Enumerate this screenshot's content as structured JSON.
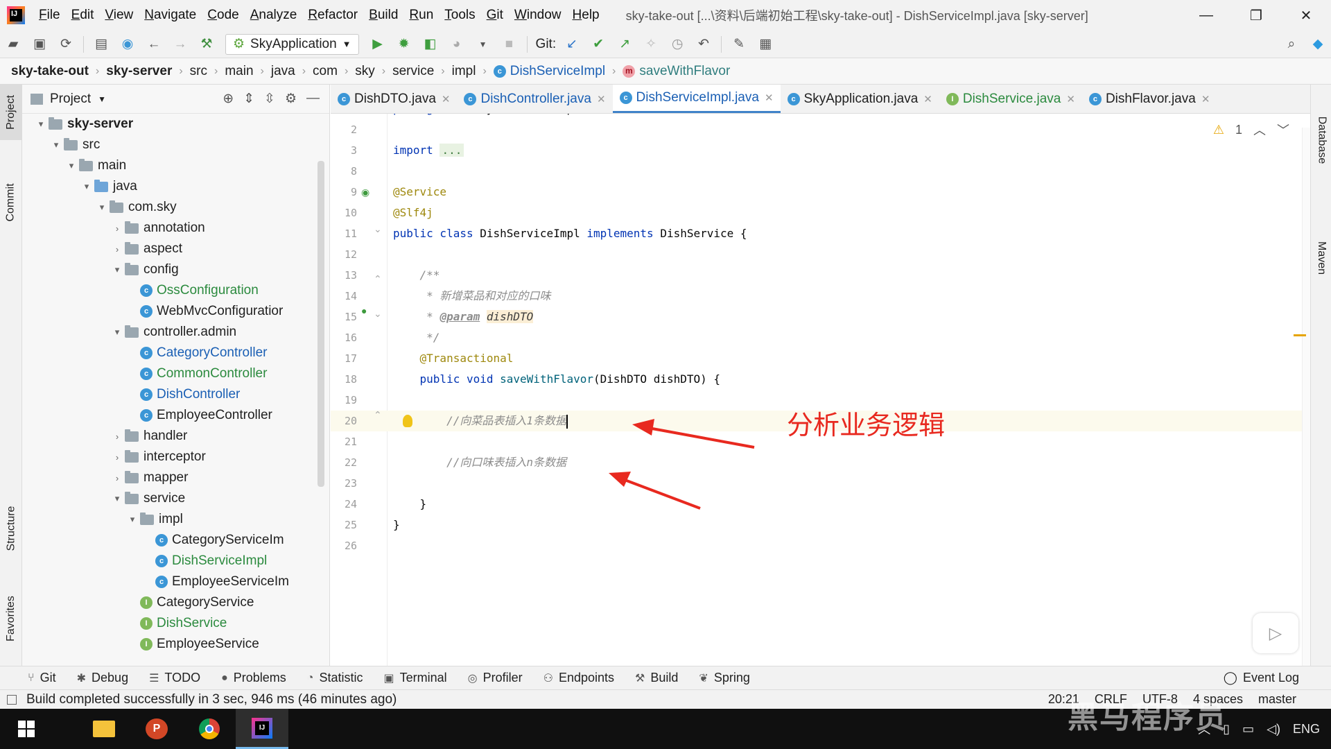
{
  "menu": {
    "items": [
      "File",
      "Edit",
      "View",
      "Navigate",
      "Code",
      "Analyze",
      "Refactor",
      "Build",
      "Run",
      "Tools",
      "Git",
      "Window",
      "Help"
    ],
    "window_title": "sky-take-out [...\\资料\\后端初始工程\\sky-take-out] - DishServiceImpl.java [sky-server]"
  },
  "toolbar": {
    "run_config": "SkyApplication",
    "git_label": "Git:"
  },
  "breadcrumb": [
    "sky-take-out",
    "sky-server",
    "src",
    "main",
    "java",
    "com",
    "sky",
    "service",
    "impl",
    "DishServiceImpl",
    "saveWithFlavor"
  ],
  "left_strip": {
    "project": "Project",
    "commit": "Commit",
    "structure": "Structure",
    "favorites": "Favorites"
  },
  "right_strip": {
    "database": "Database",
    "maven": "Maven"
  },
  "project_panel": {
    "title": "Project",
    "tree": [
      {
        "label": "sky-server",
        "depth": 0,
        "arrow": "▾",
        "kind": "module",
        "style": "bold"
      },
      {
        "label": "src",
        "depth": 1,
        "arrow": "▾",
        "kind": "folder"
      },
      {
        "label": "main",
        "depth": 2,
        "arrow": "▾",
        "kind": "folder"
      },
      {
        "label": "java",
        "depth": 3,
        "arrow": "▾",
        "kind": "folder-blue"
      },
      {
        "label": "com.sky",
        "depth": 4,
        "arrow": "▾",
        "kind": "folder"
      },
      {
        "label": "annotation",
        "depth": 5,
        "arrow": "›",
        "kind": "folder"
      },
      {
        "label": "aspect",
        "depth": 5,
        "arrow": "›",
        "kind": "folder"
      },
      {
        "label": "config",
        "depth": 5,
        "arrow": "▾",
        "kind": "folder"
      },
      {
        "label": "OssConfiguration",
        "depth": 6,
        "arrow": "",
        "kind": "class",
        "style": "green"
      },
      {
        "label": "WebMvcConfiguratior",
        "depth": 6,
        "arrow": "",
        "kind": "class"
      },
      {
        "label": "controller.admin",
        "depth": 5,
        "arrow": "▾",
        "kind": "folder"
      },
      {
        "label": "CategoryController",
        "depth": 6,
        "arrow": "",
        "kind": "class",
        "style": "blue"
      },
      {
        "label": "CommonController",
        "depth": 6,
        "arrow": "",
        "kind": "class",
        "style": "green"
      },
      {
        "label": "DishController",
        "depth": 6,
        "arrow": "",
        "kind": "class",
        "style": "blue"
      },
      {
        "label": "EmployeeController",
        "depth": 6,
        "arrow": "",
        "kind": "class"
      },
      {
        "label": "handler",
        "depth": 5,
        "arrow": "›",
        "kind": "folder"
      },
      {
        "label": "interceptor",
        "depth": 5,
        "arrow": "›",
        "kind": "folder"
      },
      {
        "label": "mapper",
        "depth": 5,
        "arrow": "›",
        "kind": "folder"
      },
      {
        "label": "service",
        "depth": 5,
        "arrow": "▾",
        "kind": "folder"
      },
      {
        "label": "impl",
        "depth": 6,
        "arrow": "▾",
        "kind": "folder"
      },
      {
        "label": "CategoryServiceIm",
        "depth": 7,
        "arrow": "",
        "kind": "class"
      },
      {
        "label": "DishServiceImpl",
        "depth": 7,
        "arrow": "",
        "kind": "class",
        "style": "green"
      },
      {
        "label": "EmployeeServiceIm",
        "depth": 7,
        "arrow": "",
        "kind": "class"
      },
      {
        "label": "CategoryService",
        "depth": 6,
        "arrow": "",
        "kind": "interface"
      },
      {
        "label": "DishService",
        "depth": 6,
        "arrow": "",
        "kind": "interface",
        "style": "green"
      },
      {
        "label": "EmployeeService",
        "depth": 6,
        "arrow": "",
        "kind": "interface"
      }
    ]
  },
  "editor_tabs": [
    {
      "label": "DishDTO.java",
      "icon": "c",
      "color": "normal"
    },
    {
      "label": "DishController.java",
      "icon": "c",
      "color": "blue"
    },
    {
      "label": "DishServiceImpl.java",
      "icon": "c",
      "color": "blue",
      "active": true
    },
    {
      "label": "SkyApplication.java",
      "icon": "c",
      "color": "normal"
    },
    {
      "label": "DishService.java",
      "icon": "i",
      "color": "green"
    },
    {
      "label": "DishFlavor.java",
      "icon": "c",
      "color": "normal"
    }
  ],
  "editor": {
    "inspection_count": "1",
    "lines": [
      {
        "n": "1",
        "html": "<span class='kw'>package</span> com.sky.service.impl;"
      },
      {
        "n": "2",
        "html": ""
      },
      {
        "n": "3",
        "html": "<span class='kw'>import</span> <span class='fold'>...</span>"
      },
      {
        "n": "8",
        "html": ""
      },
      {
        "n": "9",
        "html": "<span class='ann'>@Service</span>"
      },
      {
        "n": "10",
        "html": "<span class='ann'>@Slf4j</span>"
      },
      {
        "n": "11",
        "html": "<span class='kw'>public class</span> DishServiceImpl <span class='kw'>implements</span> DishService {"
      },
      {
        "n": "12",
        "html": ""
      },
      {
        "n": "13",
        "html": "    <span class='cmt'>/**</span>"
      },
      {
        "n": "14",
        "html": "    <span class='cmt'> * 新增菜品和对应的口味</span>"
      },
      {
        "n": "15",
        "html": "    <span class='cmt'> * </span><span class='param-tag'>@param</span> <span class='param-name'>dishDTO</span>"
      },
      {
        "n": "16",
        "html": "    <span class='cmt'> */</span>"
      },
      {
        "n": "17",
        "html": "    <span class='ann'>@Transactional</span>"
      },
      {
        "n": "18",
        "html": "    <span class='kw'>public void</span> <span class='fn'>saveWithFlavor</span>(DishDTO dishDTO) {"
      },
      {
        "n": "19",
        "html": ""
      },
      {
        "n": "20",
        "html": "        <span class='cmt'>//向菜品表插入1条数据</span><span class='caret'></span>",
        "current": true
      },
      {
        "n": "21",
        "html": ""
      },
      {
        "n": "22",
        "html": "        <span class='cmt'>//向口味表插入n条数据</span>"
      },
      {
        "n": "23",
        "html": ""
      },
      {
        "n": "24",
        "html": "    }"
      },
      {
        "n": "25",
        "html": "}"
      },
      {
        "n": "26",
        "html": ""
      }
    ]
  },
  "annotation": "分析业务逻辑",
  "bottom_tools": [
    {
      "label": "Git",
      "icon": "⑂"
    },
    {
      "label": "Debug",
      "icon": "✱"
    },
    {
      "label": "TODO",
      "icon": "☰"
    },
    {
      "label": "Problems",
      "icon": "●"
    },
    {
      "label": "Statistic",
      "icon": "◔"
    },
    {
      "label": "Terminal",
      "icon": "▣"
    },
    {
      "label": "Profiler",
      "icon": "◎"
    },
    {
      "label": "Endpoints",
      "icon": "⚇"
    },
    {
      "label": "Build",
      "icon": "⚒"
    },
    {
      "label": "Spring",
      "icon": "❦"
    }
  ],
  "event_log": "Event Log",
  "status": {
    "message": "Build completed successfully in 3 sec, 946 ms (46 minutes ago)",
    "position": "20:21",
    "line_sep": "CRLF",
    "encoding": "UTF-8",
    "indent": "4 spaces",
    "branch": "master"
  },
  "taskbar": {
    "lang": "ENG"
  },
  "watermark": "黑马程序员"
}
